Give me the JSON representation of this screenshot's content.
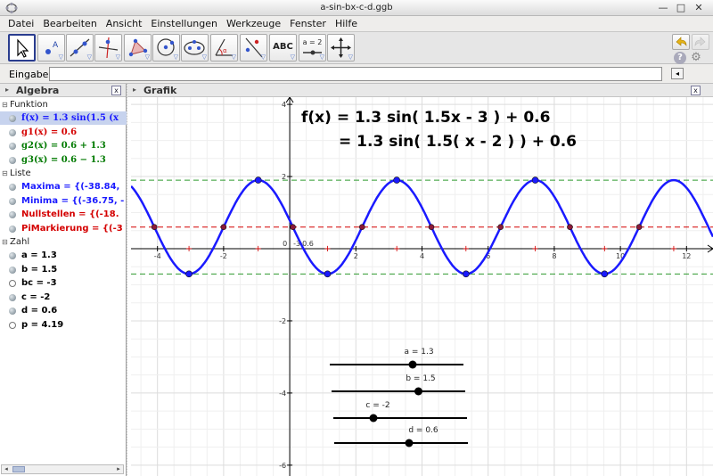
{
  "window": {
    "title": "a-sin-bx-c-d.ggb",
    "controls": [
      "—",
      "□",
      "✕"
    ]
  },
  "menu": [
    "Datei",
    "Bearbeiten",
    "Ansicht",
    "Einstellungen",
    "Werkzeuge",
    "Fenster",
    "Hilfe"
  ],
  "toolbar": {
    "tools": [
      {
        "name": "move-tool",
        "active": true
      },
      {
        "name": "point-tool"
      },
      {
        "name": "line-tool"
      },
      {
        "name": "perpendicular-line-tool"
      },
      {
        "name": "polygon-tool"
      },
      {
        "name": "circle-tool"
      },
      {
        "name": "ellipse-tool"
      },
      {
        "name": "angle-tool"
      },
      {
        "name": "reflect-tool"
      },
      {
        "name": "text-tool",
        "label": "ABC"
      },
      {
        "name": "slider-tool",
        "label": "a = 2"
      },
      {
        "name": "move-graphics-view-tool"
      }
    ],
    "undo_icon": "undo-icon",
    "redo_icon": "redo-icon",
    "help_icon": "help-icon",
    "settings_icon": "gear-icon"
  },
  "input_bar": {
    "label": "Eingabe:",
    "value": ""
  },
  "algebra": {
    "title": "Algebra",
    "close": "x",
    "categories": [
      {
        "label": "Funktion",
        "items": [
          {
            "text": "f(x)  =  1.3 sin(1.5 (x",
            "color": "#1a1aff",
            "math": true,
            "selected": true,
            "dot": "filled"
          },
          {
            "text": "g1(x)  =  0.6",
            "color": "#d40000",
            "math": true,
            "dot": "filled"
          },
          {
            "text": "g2(x)  =  0.6 + 1.3",
            "color": "#007a00",
            "math": true,
            "dot": "filled"
          },
          {
            "text": "g3(x)  =  0.6 − 1.3",
            "color": "#007a00",
            "math": true,
            "dot": "filled"
          }
        ]
      },
      {
        "label": "Liste",
        "items": [
          {
            "text": "Maxima = {(-38.84,",
            "color": "#1a1aff",
            "dot": "filled"
          },
          {
            "text": "Minima = {(-36.75, -",
            "color": "#1a1aff",
            "dot": "filled"
          },
          {
            "text": "Nullstellen = {(-18.",
            "color": "#d40000",
            "dot": "filled"
          },
          {
            "text": "PiMarkierung = {(-3",
            "color": "#d40000",
            "dot": "filled"
          }
        ]
      },
      {
        "label": "Zahl",
        "items": [
          {
            "text": "a = 1.3",
            "color": "#000",
            "dot": "filled"
          },
          {
            "text": "b = 1.5",
            "color": "#000",
            "dot": "filled"
          },
          {
            "text": "bc = -3",
            "color": "#000",
            "dot": "hollow"
          },
          {
            "text": "c = -2",
            "color": "#000",
            "dot": "filled"
          },
          {
            "text": "d = 0.6",
            "color": "#000",
            "dot": "filled"
          },
          {
            "text": "p = 4.19",
            "color": "#000",
            "dot": "hollow"
          }
        ]
      }
    ]
  },
  "graphics": {
    "title": "Grafik",
    "close": "x",
    "heading_line1": "f(x) = 1.3 sin( 1.5x - 3 ) + 0.6",
    "heading_line2": "= 1.3 sin( 1.5( x - 2 ) ) + 0.6",
    "x_ticks": [
      "-4",
      "-2",
      "2",
      "4",
      "6",
      "8",
      "10",
      "12"
    ],
    "y_ticks": [
      "4",
      "2",
      "-2",
      "-4",
      "-6"
    ],
    "origin_label": "0",
    "point_label": "0.6",
    "point_label_prefix": "-3",
    "x_range": [
      -4.8,
      12.8
    ],
    "y_range": [
      -6.3,
      4.2
    ],
    "function": {
      "a": 1.3,
      "b": 1.5,
      "c": -2,
      "d": 0.6,
      "color": "#1a1aff"
    },
    "sliders": [
      {
        "label": "a = 1.3",
        "value": 1.3,
        "min": -5,
        "max": 5,
        "fraction": 0.62
      },
      {
        "label": "b = 1.5",
        "value": 1.5,
        "min": -5,
        "max": 5,
        "fraction": 0.65
      },
      {
        "label": "c = -2",
        "value": -2,
        "min": -5,
        "max": 5,
        "fraction": 0.3
      },
      {
        "label": "d = 0.6",
        "value": 0.6,
        "min": -5,
        "max": 5,
        "fraction": 0.56
      }
    ],
    "colors": {
      "curve": "#1a1aff",
      "midline": "#d40000",
      "envelope": "#2e9a2e",
      "points": "#8b1a3a",
      "pi_marks": "#d40000"
    }
  }
}
